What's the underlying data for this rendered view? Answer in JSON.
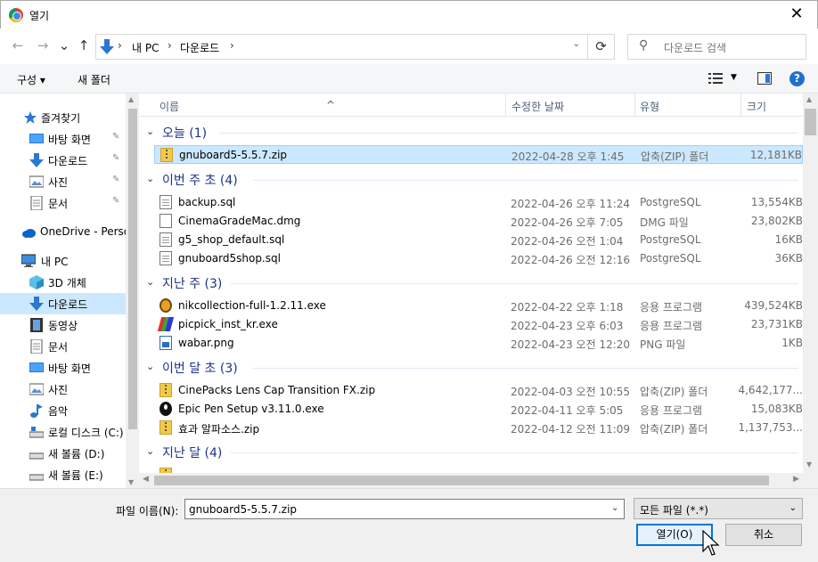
{
  "window": {
    "title": "열기",
    "close": "✕"
  },
  "nav": {
    "back": "←",
    "forward": "→",
    "up": "↑",
    "breadcrumbs": [
      "내 PC",
      "다운로드"
    ],
    "sep": "›",
    "refresh": "⟳",
    "search_placeholder": "다운로드 검색"
  },
  "toolbar": {
    "organize": "구성 ▾",
    "new_folder": "새 폴더",
    "help": "?"
  },
  "sidebar": {
    "items": [
      {
        "label": "즐겨찾기"
      },
      {
        "label": "바탕 화면"
      },
      {
        "label": "다운로드"
      },
      {
        "label": "사진"
      },
      {
        "label": "문서"
      },
      {
        "label": "OneDrive - Personal"
      },
      {
        "label": "내 PC"
      },
      {
        "label": "3D 개체"
      },
      {
        "label": "다운로드"
      },
      {
        "label": "동영상"
      },
      {
        "label": "문서"
      },
      {
        "label": "바탕 화면"
      },
      {
        "label": "사진"
      },
      {
        "label": "음악"
      },
      {
        "label": "로컬 디스크 (C:)"
      },
      {
        "label": "새 볼륨 (D:)"
      },
      {
        "label": "새 볼륨 (E:)"
      }
    ],
    "pin": "📌"
  },
  "columns": {
    "name": "이름",
    "date": "수정한 날짜",
    "type": "유형",
    "size": "크기"
  },
  "groups": [
    {
      "label": "오늘 (1)"
    },
    {
      "label": "이번 주 초 (4)"
    },
    {
      "label": "지난 주 (3)"
    },
    {
      "label": "이번 달 초 (3)"
    },
    {
      "label": "지난 달 (4)"
    }
  ],
  "files": [
    {
      "name": "gnuboard5-5.5.7.zip",
      "date": "2022-04-28 오후 1:45",
      "type": "압축(ZIP) 폴더",
      "size": "12,181KB"
    },
    {
      "name": "backup.sql",
      "date": "2022-04-26 오후 11:24",
      "type": "PostgreSQL",
      "size": "13,554KB"
    },
    {
      "name": "CinemaGradeMac.dmg",
      "date": "2022-04-26 오후 7:05",
      "type": "DMG 파일",
      "size": "23,802KB"
    },
    {
      "name": "g5_shop_default.sql",
      "date": "2022-04-26 오전 1:04",
      "type": "PostgreSQL",
      "size": "16KB"
    },
    {
      "name": "gnuboard5shop.sql",
      "date": "2022-04-26 오전 12:16",
      "type": "PostgreSQL",
      "size": "36KB"
    },
    {
      "name": "nikcollection-full-1.2.11.exe",
      "date": "2022-04-22 오후 1:18",
      "type": "응용 프로그램",
      "size": "439,524KB"
    },
    {
      "name": "picpick_inst_kr.exe",
      "date": "2022-04-23 오후 6:03",
      "type": "응용 프로그램",
      "size": "23,731KB"
    },
    {
      "name": "wabar.png",
      "date": "2022-04-23 오전 12:20",
      "type": "PNG 파일",
      "size": "1KB"
    },
    {
      "name": "CinePacks Lens Cap Transition FX.zip",
      "date": "2022-04-03 오전 10:55",
      "type": "압축(ZIP) 폴더",
      "size": "4,642,177..."
    },
    {
      "name": "Epic Pen Setup v3.11.0.exe",
      "date": "2022-04-11 오후 5:05",
      "type": "응용 프로그램",
      "size": "15,083KB"
    },
    {
      "name": "효과 알파소스.zip",
      "date": "2022-04-12 오전 11:09",
      "type": "압축(ZIP) 폴더",
      "size": "1,137,753..."
    }
  ],
  "footer": {
    "filename_label": "파일 이름(N):",
    "filename_value": "gnuboard5-5.5.7.zip",
    "filter": "모든 파일 (*.*)",
    "open": "열기(O)",
    "cancel": "취소"
  }
}
